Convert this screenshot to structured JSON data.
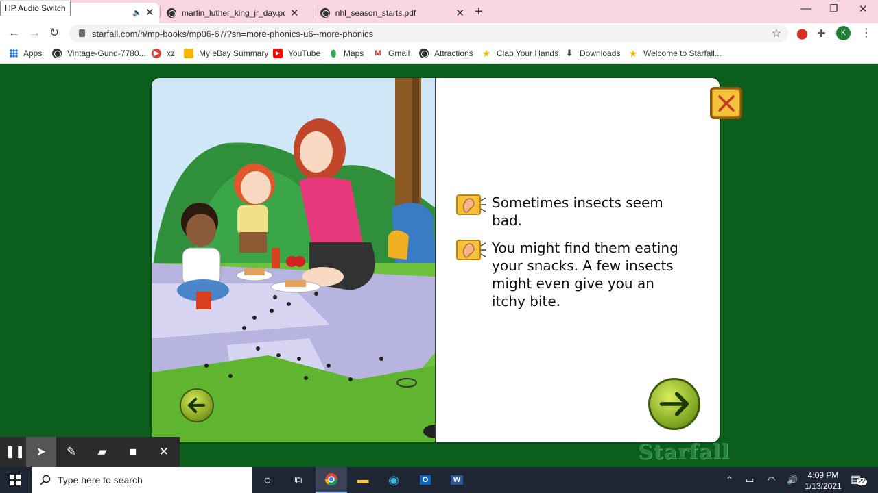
{
  "browser": {
    "tooltip": "HP Audio Switch",
    "tabs": [
      {
        "label": "",
        "active": true
      },
      {
        "label": "martin_luther_king_jr_day.pdf"
      },
      {
        "label": "nhl_season_starts.pdf"
      }
    ],
    "url": "starfall.com/h/mp-books/mp06-67/?sn=more-phonics-u6--more-phonics",
    "profile_initial": "K",
    "bookmarks": [
      {
        "label": "Apps",
        "icon": "apps-grid-icon"
      },
      {
        "label": "Vintage-Gund-7780...",
        "icon": "globe-icon"
      },
      {
        "label": "xz",
        "icon": "play-icon"
      },
      {
        "label": "My eBay Summary",
        "icon": "bag-icon"
      },
      {
        "label": "YouTube",
        "icon": "youtube-icon"
      },
      {
        "label": "Maps",
        "icon": "maps-pin-icon"
      },
      {
        "label": "Gmail",
        "icon": "gmail-icon"
      },
      {
        "label": "Attractions",
        "icon": "globe-icon"
      },
      {
        "label": "Clap Your Hands",
        "icon": "starfall-star-icon"
      },
      {
        "label": "Downloads",
        "icon": "download-icon"
      },
      {
        "label": "Welcome to Starfall...",
        "icon": "starfall-star-icon"
      }
    ]
  },
  "book": {
    "lines": [
      "Sometimes insects seem bad.",
      "You might find them eating your snacks. A few insects might even give you an itchy bite."
    ],
    "logo": "Starfall"
  },
  "taskbar": {
    "search_placeholder": "Type here to search",
    "time": "4:09 PM",
    "date": "1/13/2021",
    "notifications": "22"
  },
  "colors": {
    "page_bg": "#0b5e1c",
    "tab_strip": "#f9d6e1",
    "button_gold": "#f7c23b",
    "arrow_green": "#79a21f"
  }
}
